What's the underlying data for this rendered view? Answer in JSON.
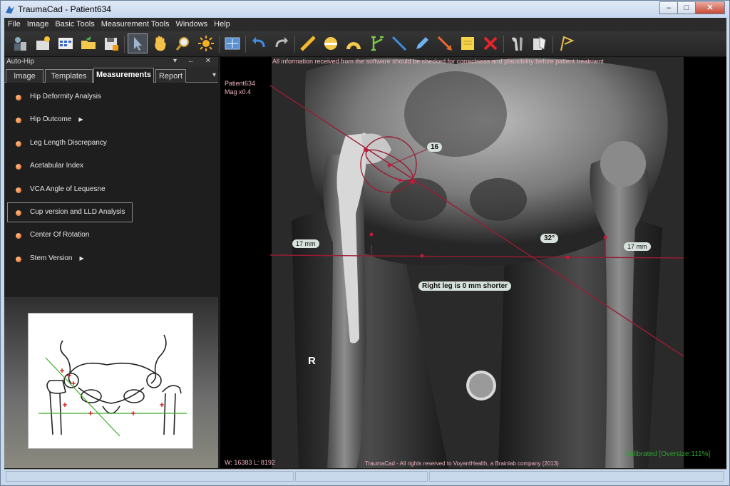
{
  "window": {
    "title": "TraumaCad - Patient634",
    "minimize": "–",
    "maximize": "□",
    "close": "✕"
  },
  "menu": [
    "File",
    "Image",
    "Basic Tools",
    "Measurement Tools",
    "Windows",
    "Help"
  ],
  "toolbar": {
    "icons": [
      "patient-icon",
      "new-study-icon",
      "image-grid-icon",
      "open-folder-icon",
      "save-icon",
      "pointer-icon",
      "pan-hand-icon",
      "zoom-icon",
      "brightness-icon",
      "fit-screen-icon",
      "undo-icon",
      "redo-icon",
      "ruler-icon",
      "circle-tool-icon",
      "angle-tool-icon",
      "caliper-tool-icon",
      "line-tool-icon",
      "pencil-tool-icon",
      "arrow-tool-icon",
      "note-tool-icon",
      "delete-icon",
      "implant-icon",
      "template-icon",
      "flag-icon"
    ]
  },
  "panel": {
    "title": "Auto-Hip",
    "header_icons": "▾ ← ✕",
    "tabs": [
      "Image",
      "Templates",
      "Measurements",
      "Report"
    ],
    "active_tab": "Measurements",
    "items": [
      {
        "label": "Hip Deformity Analysis",
        "submenu": false
      },
      {
        "label": "Hip Outcome",
        "submenu": true
      },
      {
        "label": "Leg Length Discrepancy",
        "submenu": false
      },
      {
        "label": "Acetabular Index",
        "submenu": false
      },
      {
        "label": "VCA Angle of Lequesne",
        "submenu": false
      },
      {
        "label": "Cup version and LLD Analysis",
        "submenu": false,
        "selected": true
      },
      {
        "label": "Center Of Rotation",
        "submenu": false
      },
      {
        "label": "Stem Version",
        "submenu": true
      }
    ],
    "submenu_arrow": "▶"
  },
  "viewer": {
    "disclaimer": "All information received from the software should be checked for correctness and plausibility before patient treatment",
    "patient": "Patient634",
    "magnification": "Mag x0.4",
    "side_marker": "R",
    "window_level": "W:  16383 L: 8192",
    "copyright": "TraumaCad -  All rights reserved to VoyantHealth, a Brainlab company  (2013)",
    "calibration": "Calibrated [Oversize:111%]",
    "labels": {
      "cup_angle": "16",
      "pelvic_angle": "32°",
      "left_offset": "17 mm",
      "right_offset": "17 mm",
      "lld_result": "Right leg is 0 mm shorter"
    }
  },
  "colors": {
    "measurement": "#9b1b33",
    "calibrated": "#2fa62f",
    "overlay_text": "#f0b4c0",
    "accent_dot": "#e4621a"
  }
}
